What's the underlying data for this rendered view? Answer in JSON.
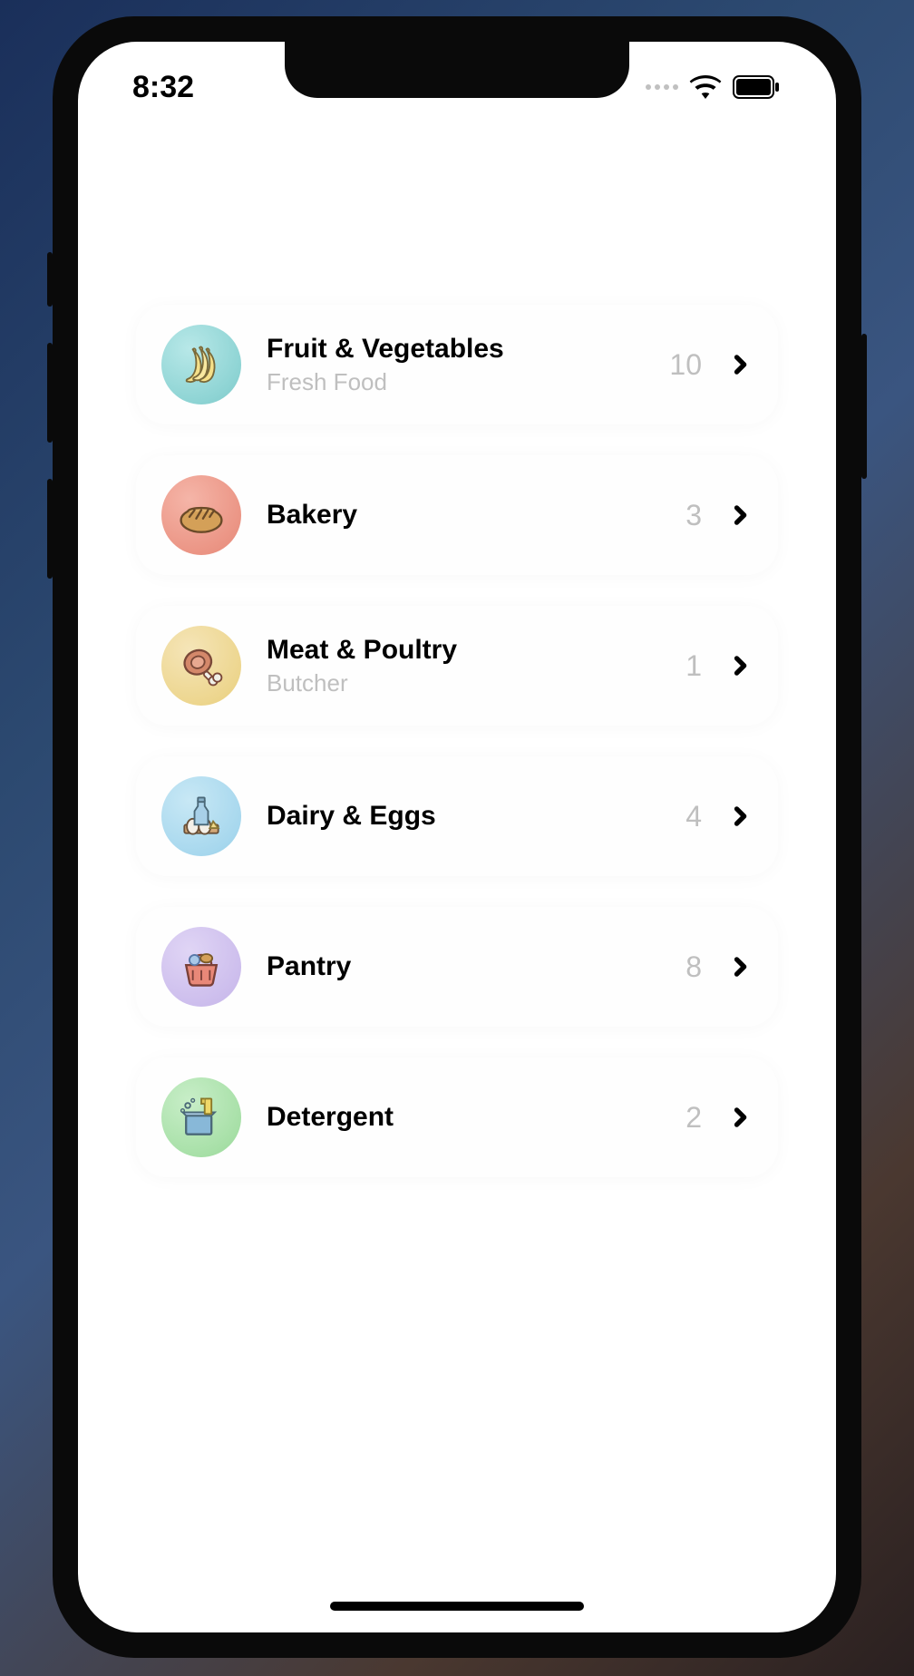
{
  "status": {
    "time": "8:32"
  },
  "categories": [
    {
      "title": "Fruit & Vegetables",
      "subtitle": "Fresh Food",
      "count": "10",
      "icon": "banana",
      "bg": "bg-teal"
    },
    {
      "title": "Bakery",
      "subtitle": "",
      "count": "3",
      "icon": "bread",
      "bg": "bg-red"
    },
    {
      "title": "Meat & Poultry",
      "subtitle": "Butcher",
      "count": "1",
      "icon": "meat",
      "bg": "bg-yellow"
    },
    {
      "title": "Dairy & Eggs",
      "subtitle": "",
      "count": "4",
      "icon": "dairy",
      "bg": "bg-blue"
    },
    {
      "title": "Pantry",
      "subtitle": "",
      "count": "8",
      "icon": "basket",
      "bg": "bg-purple"
    },
    {
      "title": "Detergent",
      "subtitle": "",
      "count": "2",
      "icon": "cleaning",
      "bg": "bg-green"
    }
  ]
}
